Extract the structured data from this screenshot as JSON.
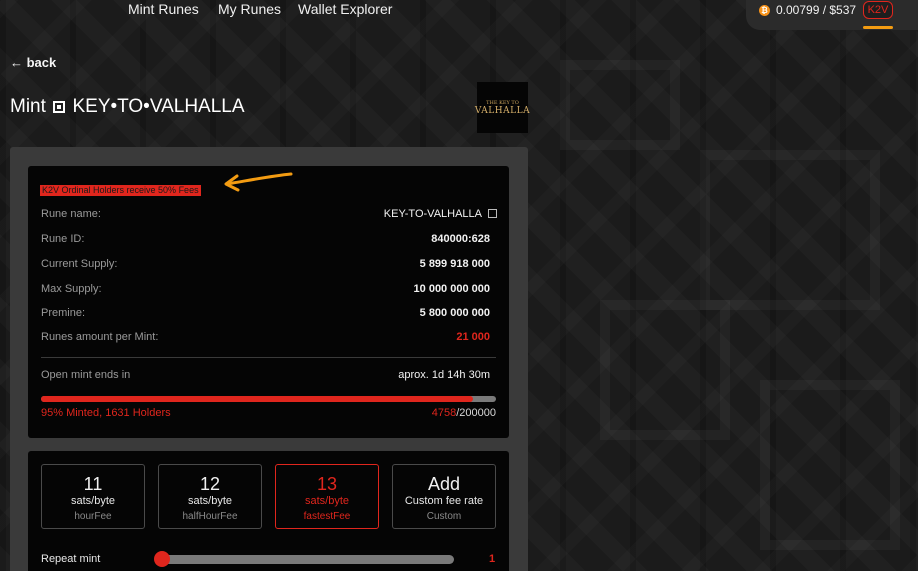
{
  "nav": {
    "links": [
      "Mint Runes",
      "My Runes",
      "Wallet Explorer"
    ],
    "wallet_amount": "0.00799 / $537",
    "wallet_token": "K2V"
  },
  "page": {
    "back": "← back",
    "title_prefix": "Mint",
    "title_rune": "KEY•TO•VALHALLA",
    "logo_top": "THE KEY TO",
    "logo_bottom": "VALHALLA"
  },
  "info": {
    "promo": "K2V Ordinal Holders receive 50% Fees",
    "rows": [
      {
        "label": "Rune name:",
        "value": "KEY-TO-VALHALLA"
      },
      {
        "label": "Rune ID:",
        "value": "840000:628"
      },
      {
        "label": "Current Supply:",
        "value": "5 899 918 000"
      },
      {
        "label": "Max Supply:",
        "value": "10 000 000 000"
      },
      {
        "label": "Premine:",
        "value": "5 800 000 000"
      },
      {
        "label": "Runes amount per Mint:",
        "value": "21 000"
      }
    ],
    "mint_end_label": "Open mint ends in",
    "mint_end_value": "aprox. 1d 14h 30m",
    "progress_fraction": 0.95,
    "minted_text": "95% Minted, 1631 Holders",
    "count_current": "4758",
    "count_total": "/200000"
  },
  "fees": [
    {
      "big": "11",
      "unit": "sats/byte",
      "sub": "hourFee",
      "selected": false
    },
    {
      "big": "12",
      "unit": "sats/byte",
      "sub": "halfHourFee",
      "selected": false
    },
    {
      "big": "13",
      "unit": "sats/byte",
      "sub": "fastestFee",
      "selected": true
    },
    {
      "big": "Add",
      "unit": "Custom fee rate",
      "sub": "Custom",
      "selected": false
    }
  ],
  "repeat": {
    "label": "Repeat mint",
    "value": "1"
  },
  "colors": {
    "accent": "#e0261d",
    "highlight": "#f39c12",
    "bitcoin": "#f7931a"
  }
}
